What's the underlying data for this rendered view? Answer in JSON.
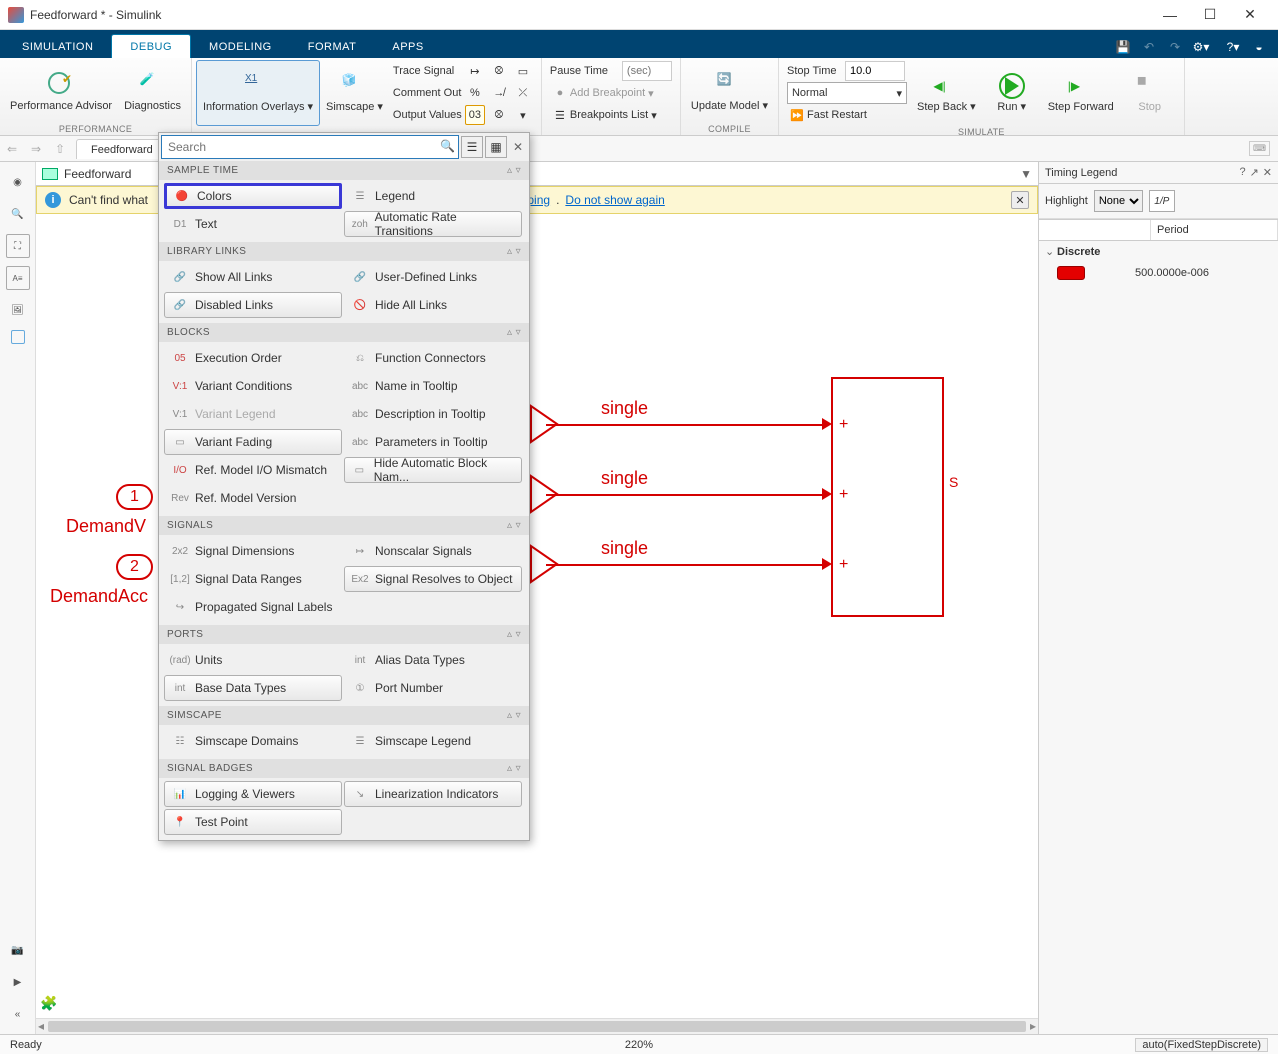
{
  "window": {
    "title": "Feedforward * - Simulink"
  },
  "tabs": [
    "SIMULATION",
    "DEBUG",
    "MODELING",
    "FORMAT",
    "APPS"
  ],
  "active_tab": "DEBUG",
  "toolstrip": {
    "performance": {
      "btn1": "Performance\nAdvisor",
      "btn2": "Diagnostics",
      "label": "PERFORMANCE"
    },
    "info_overlays": "Information\nOverlays",
    "simscape": "Simscape",
    "trace_signal": "Trace Signal",
    "comment_out": "Comment Out",
    "output_values": "Output Values",
    "pause_time": "Pause Time",
    "pause_placeholder": "(sec)",
    "add_breakpoint": "Add Breakpoint",
    "breakpoints_list": "Breakpoints List",
    "compile": {
      "update_model": "Update\nModel",
      "label": "COMPILE"
    },
    "simulate": {
      "stop_time": "Stop Time",
      "stop_time_val": "10.0",
      "mode": "Normal",
      "fast_restart": "Fast Restart",
      "step_back": "Step\nBack",
      "run": "Run",
      "step_fwd": "Step\nForward",
      "stop": "Stop",
      "label": "SIMULATE"
    }
  },
  "crumb": {
    "tab": "Feedforward"
  },
  "path_bar": "Feedforward",
  "notification": {
    "text_prefix": "Can't find what ",
    "link1": "p Mapping",
    "link2": "Do not show again"
  },
  "canvas": {
    "port1_num": "1",
    "port2_num": "2",
    "port1_name": "DemandV",
    "port2_name": "DemandAcc",
    "signal_type": "single",
    "outport_label": "S"
  },
  "overlay": {
    "search_placeholder": "Search",
    "sections": {
      "sample_time": {
        "title": "SAMPLE TIME",
        "items_left": [
          "Colors",
          "Text"
        ],
        "items_right": [
          "Legend",
          "Automatic Rate Transitions"
        ]
      },
      "library_links": {
        "title": "LIBRARY LINKS",
        "items_left": [
          "Show All Links",
          "Disabled Links"
        ],
        "items_right": [
          "User-Defined Links",
          "Hide All Links"
        ]
      },
      "blocks": {
        "title": "BLOCKS",
        "items_left": [
          "Execution Order",
          "Variant Conditions",
          "Variant Legend",
          "Variant Fading",
          "Ref. Model I/O Mismatch",
          "Ref. Model Version"
        ],
        "items_right": [
          "Function Connectors",
          "Name in Tooltip",
          "Description in Tooltip",
          "Parameters in Tooltip",
          "Hide Automatic Block Nam..."
        ]
      },
      "signals": {
        "title": "SIGNALS",
        "items_left": [
          "Signal Dimensions",
          "Signal Data Ranges",
          "Propagated Signal Labels"
        ],
        "items_right": [
          "Nonscalar Signals",
          "Signal Resolves to Object"
        ]
      },
      "ports": {
        "title": "PORTS",
        "items_left": [
          "Units",
          "Base Data Types"
        ],
        "items_right": [
          "Alias Data Types",
          "Port Number"
        ]
      },
      "simscape": {
        "title": "SIMSCAPE",
        "items_left": [
          "Simscape Domains"
        ],
        "items_right": [
          "Simscape Legend"
        ]
      },
      "signal_badges": {
        "title": "SIGNAL BADGES",
        "items_left": [
          "Logging & Viewers",
          "Test Point"
        ],
        "items_right": [
          "Linearization Indicators"
        ]
      }
    }
  },
  "timing_legend": {
    "title": "Timing Legend",
    "highlight_label": "Highlight",
    "highlight_value": "None",
    "p_btn": "1/P",
    "col1": "Discrete",
    "col2": "Period",
    "swatch_color": "#e30000",
    "period_val": "500.0000e-006"
  },
  "status": {
    "ready": "Ready",
    "zoom": "220%",
    "solver": "auto(FixedStepDiscrete)"
  }
}
